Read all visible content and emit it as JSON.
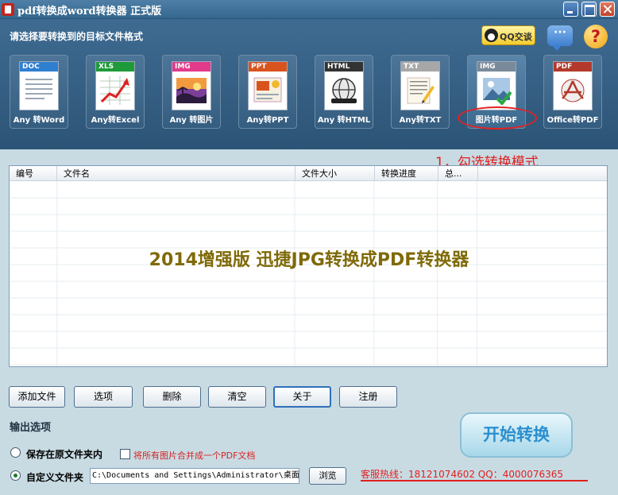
{
  "window": {
    "title": "pdf转换成word转换器  正式版"
  },
  "header": {
    "prompt": "请选择要转换到的目标文件格式",
    "qq_button": "QQ交谈",
    "chat_icon_text": "···",
    "help_icon_text": "?"
  },
  "formats": [
    {
      "tag": "DOC",
      "label": "Any 转Word",
      "band_color": "#2f7fd0",
      "icon": "word-doc-icon"
    },
    {
      "tag": "XLS",
      "label": "Any转Excel",
      "band_color": "#1f9a3a",
      "icon": "excel-chart-icon"
    },
    {
      "tag": "IMG",
      "label": "Any 转图片",
      "band_color": "#e23b8a",
      "icon": "image-sunset-icon"
    },
    {
      "tag": "PPT",
      "label": "Any转PPT",
      "band_color": "#d9531e",
      "icon": "ppt-slides-icon"
    },
    {
      "tag": "HTML",
      "label": "Any 转HTML",
      "band_color": "#333333",
      "icon": "html-globe-icon"
    },
    {
      "tag": "TXT",
      "label": "Any转TXT",
      "band_color": "#a7a7a7",
      "icon": "txt-pencil-icon"
    },
    {
      "tag": "IMG",
      "label": "图片转PDF",
      "band_color": "#7a8a9a",
      "icon": "image-to-pdf-icon",
      "selected": true
    },
    {
      "tag": "PDF",
      "label": "Office转PDF",
      "band_color": "#b3392c",
      "icon": "office-to-pdf-icon"
    }
  ],
  "annotation": {
    "hint": "1，勾选转换模式"
  },
  "table": {
    "columns": [
      "编号",
      "文件名",
      "文件大小",
      "转换进度",
      "总..."
    ],
    "rows": [],
    "watermark": "2014增强版 迅捷JPG转换成PDF转换器"
  },
  "actions": [
    "添加文件",
    "选项",
    "删除",
    "清空",
    "关于",
    "注册"
  ],
  "output": {
    "title": "输出选项",
    "option_original": "保存在原文件夹内",
    "merge_label": "将所有图片合并成一个PDF文档",
    "merge_checked": false,
    "option_custom": "自定义文件夹",
    "selected_option": "custom",
    "path": "C:\\Documents and Settings\\Administrator\\桌面",
    "browse_button": "浏览"
  },
  "start_button": "开始转换",
  "hotline": "客服热线：18121074602 QQ：4000076365",
  "colors": {
    "accent_red": "#e22020",
    "header_blue": "#355d80",
    "watermark": "#7f6a08",
    "start_text": "#2a8fcf"
  }
}
